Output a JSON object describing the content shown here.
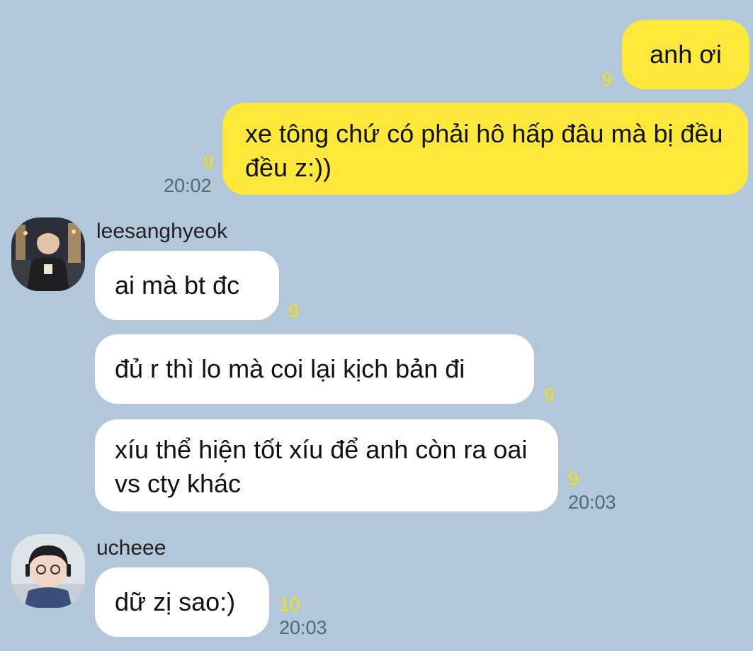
{
  "messages_out": [
    {
      "text": "anh ơi",
      "unread": "9"
    },
    {
      "text": "xe tông chứ có phải hô hấp đâu mà bị đều đều z:))",
      "unread": "9",
      "time": "20:02"
    }
  ],
  "group1": {
    "sender": "leesanghyeok",
    "messages": [
      {
        "text": "ai mà bt đc",
        "unread": "9"
      },
      {
        "text": "đủ r thì lo mà coi lại kịch bản đi",
        "unread": "9"
      },
      {
        "text": "xíu thể hiện tốt xíu để anh còn ra oai vs cty khác",
        "unread": "9",
        "time": "20:03"
      }
    ]
  },
  "group2": {
    "sender": "ucheee",
    "messages": [
      {
        "text": "dữ zị sao:)",
        "unread": "10",
        "time": "20:03"
      }
    ]
  },
  "colors": {
    "background": "#b2c7d9",
    "outgoing_bubble": "#fee93a",
    "incoming_bubble": "#ffffff",
    "unread_count": "#f6e400"
  }
}
